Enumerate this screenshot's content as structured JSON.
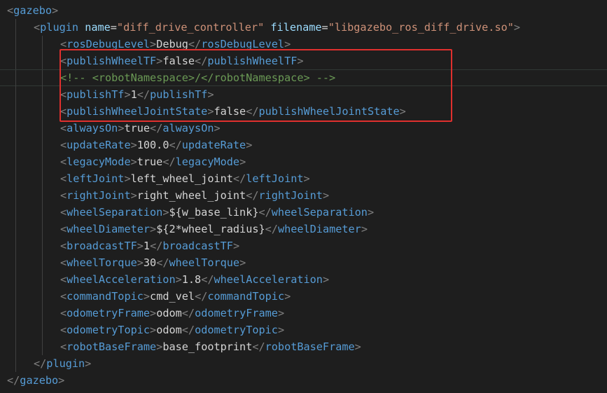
{
  "editor": {
    "colors": {
      "background": "#1e1e1e",
      "tag": "#569cd6",
      "bracket": "#808080",
      "attribute": "#9cdcfe",
      "string": "#ce9178",
      "text": "#d4d4d4",
      "comment": "#6a9955",
      "annotation_box": "#e0302e"
    },
    "lines": [
      {
        "indent": 0,
        "kind": "open",
        "tag": "gazebo"
      },
      {
        "indent": 1,
        "kind": "open_attrs",
        "tag": "plugin",
        "attrs": [
          {
            "name": "name",
            "value": "\"diff_drive_controller\""
          },
          {
            "name": "filename",
            "value": "\"libgazebo_ros_diff_drive.so\""
          }
        ]
      },
      {
        "indent": 2,
        "kind": "element",
        "tag": "rosDebugLevel",
        "value": "Debug"
      },
      {
        "indent": 2,
        "kind": "element",
        "tag": "publishWheelTF",
        "value": "false"
      },
      {
        "indent": 2,
        "kind": "comment",
        "text": "<!-- <robotNamespace>/</robotNamespace> -->",
        "current": true
      },
      {
        "indent": 2,
        "kind": "element",
        "tag": "publishTf",
        "value": "1"
      },
      {
        "indent": 2,
        "kind": "element",
        "tag": "publishWheelJointState",
        "value": "false"
      },
      {
        "indent": 2,
        "kind": "element",
        "tag": "alwaysOn",
        "value": "true"
      },
      {
        "indent": 2,
        "kind": "element",
        "tag": "updateRate",
        "value": "100.0"
      },
      {
        "indent": 2,
        "kind": "element",
        "tag": "legacyMode",
        "value": "true"
      },
      {
        "indent": 2,
        "kind": "element",
        "tag": "leftJoint",
        "value": "left_wheel_joint"
      },
      {
        "indent": 2,
        "kind": "element",
        "tag": "rightJoint",
        "value": "right_wheel_joint"
      },
      {
        "indent": 2,
        "kind": "element",
        "tag": "wheelSeparation",
        "value": "${w_base_link}"
      },
      {
        "indent": 2,
        "kind": "element",
        "tag": "wheelDiameter",
        "value": "${2*wheel_radius}"
      },
      {
        "indent": 2,
        "kind": "element",
        "tag": "broadcastTF",
        "value": "1"
      },
      {
        "indent": 2,
        "kind": "element",
        "tag": "wheelTorque",
        "value": "30"
      },
      {
        "indent": 2,
        "kind": "element",
        "tag": "wheelAcceleration",
        "value": "1.8"
      },
      {
        "indent": 2,
        "kind": "element",
        "tag": "commandTopic",
        "value": "cmd_vel"
      },
      {
        "indent": 2,
        "kind": "element",
        "tag": "odometryFrame",
        "value": "odom"
      },
      {
        "indent": 2,
        "kind": "element",
        "tag": "odometryTopic",
        "value": "odom"
      },
      {
        "indent": 2,
        "kind": "element",
        "tag": "robotBaseFrame",
        "value": "base_footprint"
      },
      {
        "indent": 1,
        "kind": "close",
        "tag": "plugin"
      },
      {
        "indent": 0,
        "kind": "close",
        "tag": "gazebo"
      }
    ]
  }
}
